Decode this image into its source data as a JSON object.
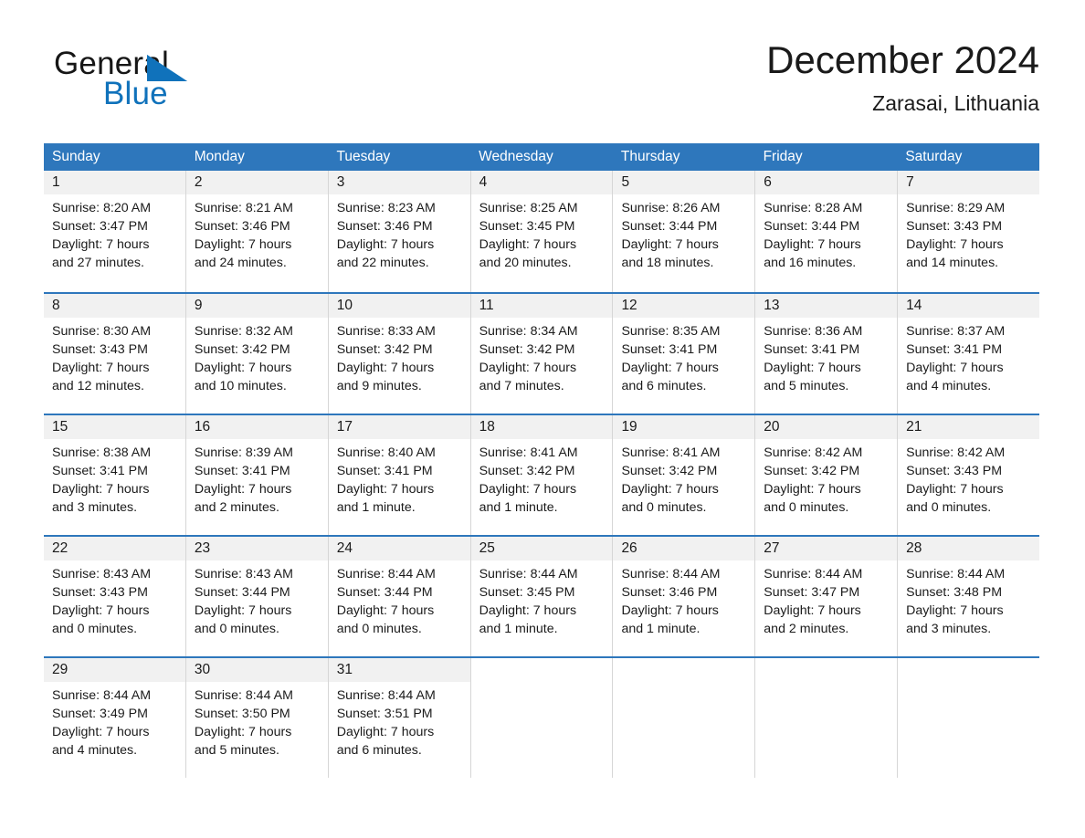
{
  "brand": {
    "line1": "General",
    "line2": "Blue",
    "mark_icon": "triangle-logo-icon",
    "color_primary": "#1072bb",
    "color_text": "#161616"
  },
  "header": {
    "title": "December 2024",
    "location": "Zarasai, Lithuania"
  },
  "theme": {
    "header_blue": "#2e77bc",
    "day_band_gray": "#f1f1f1",
    "cell_border": "#d6d6d6"
  },
  "calendar": {
    "weekdays": [
      "Sunday",
      "Monday",
      "Tuesday",
      "Wednesday",
      "Thursday",
      "Friday",
      "Saturday"
    ],
    "weeks": [
      [
        {
          "day": "1",
          "sunrise": "Sunrise: 8:20 AM",
          "sunset": "Sunset: 3:47 PM",
          "daylight1": "Daylight: 7 hours",
          "daylight2": "and 27 minutes."
        },
        {
          "day": "2",
          "sunrise": "Sunrise: 8:21 AM",
          "sunset": "Sunset: 3:46 PM",
          "daylight1": "Daylight: 7 hours",
          "daylight2": "and 24 minutes."
        },
        {
          "day": "3",
          "sunrise": "Sunrise: 8:23 AM",
          "sunset": "Sunset: 3:46 PM",
          "daylight1": "Daylight: 7 hours",
          "daylight2": "and 22 minutes."
        },
        {
          "day": "4",
          "sunrise": "Sunrise: 8:25 AM",
          "sunset": "Sunset: 3:45 PM",
          "daylight1": "Daylight: 7 hours",
          "daylight2": "and 20 minutes."
        },
        {
          "day": "5",
          "sunrise": "Sunrise: 8:26 AM",
          "sunset": "Sunset: 3:44 PM",
          "daylight1": "Daylight: 7 hours",
          "daylight2": "and 18 minutes."
        },
        {
          "day": "6",
          "sunrise": "Sunrise: 8:28 AM",
          "sunset": "Sunset: 3:44 PM",
          "daylight1": "Daylight: 7 hours",
          "daylight2": "and 16 minutes."
        },
        {
          "day": "7",
          "sunrise": "Sunrise: 8:29 AM",
          "sunset": "Sunset: 3:43 PM",
          "daylight1": "Daylight: 7 hours",
          "daylight2": "and 14 minutes."
        }
      ],
      [
        {
          "day": "8",
          "sunrise": "Sunrise: 8:30 AM",
          "sunset": "Sunset: 3:43 PM",
          "daylight1": "Daylight: 7 hours",
          "daylight2": "and 12 minutes."
        },
        {
          "day": "9",
          "sunrise": "Sunrise: 8:32 AM",
          "sunset": "Sunset: 3:42 PM",
          "daylight1": "Daylight: 7 hours",
          "daylight2": "and 10 minutes."
        },
        {
          "day": "10",
          "sunrise": "Sunrise: 8:33 AM",
          "sunset": "Sunset: 3:42 PM",
          "daylight1": "Daylight: 7 hours",
          "daylight2": "and 9 minutes."
        },
        {
          "day": "11",
          "sunrise": "Sunrise: 8:34 AM",
          "sunset": "Sunset: 3:42 PM",
          "daylight1": "Daylight: 7 hours",
          "daylight2": "and 7 minutes."
        },
        {
          "day": "12",
          "sunrise": "Sunrise: 8:35 AM",
          "sunset": "Sunset: 3:41 PM",
          "daylight1": "Daylight: 7 hours",
          "daylight2": "and 6 minutes."
        },
        {
          "day": "13",
          "sunrise": "Sunrise: 8:36 AM",
          "sunset": "Sunset: 3:41 PM",
          "daylight1": "Daylight: 7 hours",
          "daylight2": "and 5 minutes."
        },
        {
          "day": "14",
          "sunrise": "Sunrise: 8:37 AM",
          "sunset": "Sunset: 3:41 PM",
          "daylight1": "Daylight: 7 hours",
          "daylight2": "and 4 minutes."
        }
      ],
      [
        {
          "day": "15",
          "sunrise": "Sunrise: 8:38 AM",
          "sunset": "Sunset: 3:41 PM",
          "daylight1": "Daylight: 7 hours",
          "daylight2": "and 3 minutes."
        },
        {
          "day": "16",
          "sunrise": "Sunrise: 8:39 AM",
          "sunset": "Sunset: 3:41 PM",
          "daylight1": "Daylight: 7 hours",
          "daylight2": "and 2 minutes."
        },
        {
          "day": "17",
          "sunrise": "Sunrise: 8:40 AM",
          "sunset": "Sunset: 3:41 PM",
          "daylight1": "Daylight: 7 hours",
          "daylight2": "and 1 minute."
        },
        {
          "day": "18",
          "sunrise": "Sunrise: 8:41 AM",
          "sunset": "Sunset: 3:42 PM",
          "daylight1": "Daylight: 7 hours",
          "daylight2": "and 1 minute."
        },
        {
          "day": "19",
          "sunrise": "Sunrise: 8:41 AM",
          "sunset": "Sunset: 3:42 PM",
          "daylight1": "Daylight: 7 hours",
          "daylight2": "and 0 minutes."
        },
        {
          "day": "20",
          "sunrise": "Sunrise: 8:42 AM",
          "sunset": "Sunset: 3:42 PM",
          "daylight1": "Daylight: 7 hours",
          "daylight2": "and 0 minutes."
        },
        {
          "day": "21",
          "sunrise": "Sunrise: 8:42 AM",
          "sunset": "Sunset: 3:43 PM",
          "daylight1": "Daylight: 7 hours",
          "daylight2": "and 0 minutes."
        }
      ],
      [
        {
          "day": "22",
          "sunrise": "Sunrise: 8:43 AM",
          "sunset": "Sunset: 3:43 PM",
          "daylight1": "Daylight: 7 hours",
          "daylight2": "and 0 minutes."
        },
        {
          "day": "23",
          "sunrise": "Sunrise: 8:43 AM",
          "sunset": "Sunset: 3:44 PM",
          "daylight1": "Daylight: 7 hours",
          "daylight2": "and 0 minutes."
        },
        {
          "day": "24",
          "sunrise": "Sunrise: 8:44 AM",
          "sunset": "Sunset: 3:44 PM",
          "daylight1": "Daylight: 7 hours",
          "daylight2": "and 0 minutes."
        },
        {
          "day": "25",
          "sunrise": "Sunrise: 8:44 AM",
          "sunset": "Sunset: 3:45 PM",
          "daylight1": "Daylight: 7 hours",
          "daylight2": "and 1 minute."
        },
        {
          "day": "26",
          "sunrise": "Sunrise: 8:44 AM",
          "sunset": "Sunset: 3:46 PM",
          "daylight1": "Daylight: 7 hours",
          "daylight2": "and 1 minute."
        },
        {
          "day": "27",
          "sunrise": "Sunrise: 8:44 AM",
          "sunset": "Sunset: 3:47 PM",
          "daylight1": "Daylight: 7 hours",
          "daylight2": "and 2 minutes."
        },
        {
          "day": "28",
          "sunrise": "Sunrise: 8:44 AM",
          "sunset": "Sunset: 3:48 PM",
          "daylight1": "Daylight: 7 hours",
          "daylight2": "and 3 minutes."
        }
      ],
      [
        {
          "day": "29",
          "sunrise": "Sunrise: 8:44 AM",
          "sunset": "Sunset: 3:49 PM",
          "daylight1": "Daylight: 7 hours",
          "daylight2": "and 4 minutes."
        },
        {
          "day": "30",
          "sunrise": "Sunrise: 8:44 AM",
          "sunset": "Sunset: 3:50 PM",
          "daylight1": "Daylight: 7 hours",
          "daylight2": "and 5 minutes."
        },
        {
          "day": "31",
          "sunrise": "Sunrise: 8:44 AM",
          "sunset": "Sunset: 3:51 PM",
          "daylight1": "Daylight: 7 hours",
          "daylight2": "and 6 minutes."
        },
        {
          "day": "",
          "sunrise": "",
          "sunset": "",
          "daylight1": "",
          "daylight2": ""
        },
        {
          "day": "",
          "sunrise": "",
          "sunset": "",
          "daylight1": "",
          "daylight2": ""
        },
        {
          "day": "",
          "sunrise": "",
          "sunset": "",
          "daylight1": "",
          "daylight2": ""
        },
        {
          "day": "",
          "sunrise": "",
          "sunset": "",
          "daylight1": "",
          "daylight2": ""
        }
      ]
    ]
  }
}
